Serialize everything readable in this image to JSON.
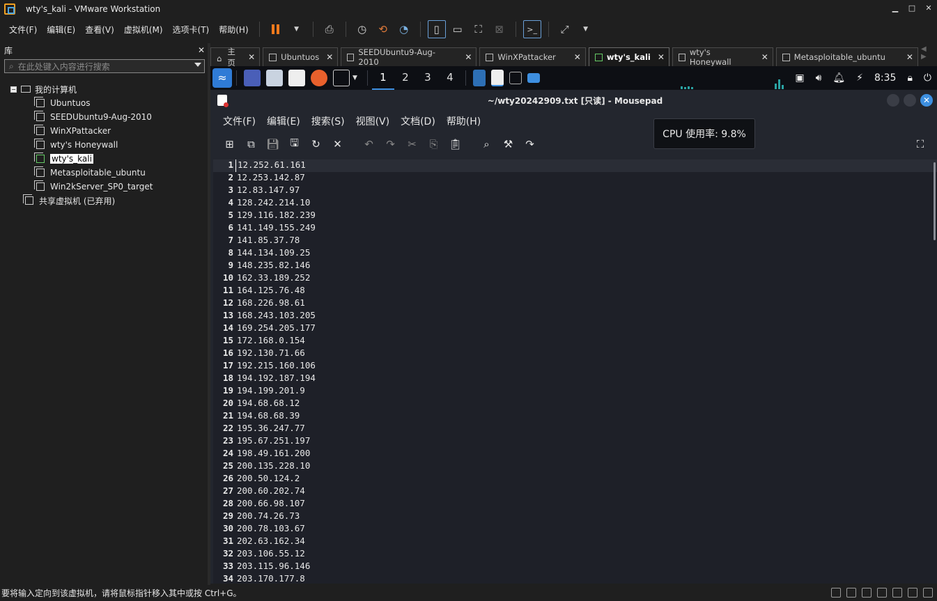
{
  "window": {
    "title": "wty's_kali - VMware Workstation",
    "controls": [
      "▁",
      "□",
      "✕"
    ]
  },
  "menubar": {
    "items": [
      "文件(F)",
      "编辑(E)",
      "查看(V)",
      "虚拟机(M)",
      "选项卡(T)",
      "帮助(H)"
    ]
  },
  "library": {
    "title": "库",
    "close": "✕",
    "search_placeholder": "在此处键入内容进行搜索",
    "tree": {
      "root": "我的计算机",
      "expander": "−",
      "vms": [
        "Ubuntuos",
        "SEEDUbuntu9-Aug-2010",
        "WinXPattacker",
        "wty's Honeywall",
        "wty's_kali",
        "Metasploitable_ubuntu",
        "Win2kServer_SP0_target"
      ],
      "selected_index": 4,
      "shared": "共享虚拟机 (已弃用)"
    }
  },
  "tabs": [
    {
      "label": "主页",
      "active": false
    },
    {
      "label": "Ubuntuos",
      "active": false
    },
    {
      "label": "SEEDUbuntu9-Aug-2010",
      "active": false
    },
    {
      "label": "WinXPattacker",
      "active": false
    },
    {
      "label": "wty's_kali",
      "active": true
    },
    {
      "label": "wty's Honeywall",
      "active": false
    },
    {
      "label": "Metasploitable_ubuntu",
      "active": false
    }
  ],
  "tab_close": "✕",
  "tab_nav": "◀  ▶",
  "guest_panel": {
    "workspaces": [
      "1",
      "2",
      "3",
      "4"
    ],
    "active_workspace": 0,
    "clock": "8:35",
    "cpu_tooltip": "CPU 使用率: 9.8%"
  },
  "mousepad": {
    "title": "~/wty20242909.txt [只读] - Mousepad",
    "menu": [
      "文件(F)",
      "编辑(E)",
      "搜索(S)",
      "视图(V)",
      "文档(D)",
      "帮助(H)"
    ],
    "lines": [
      "12.252.61.161",
      "12.253.142.87",
      "12.83.147.97",
      "128.242.214.10",
      "129.116.182.239",
      "141.149.155.249",
      "141.85.37.78",
      "144.134.109.25",
      "148.235.82.146",
      "162.33.189.252",
      "164.125.76.48",
      "168.226.98.61",
      "168.243.103.205",
      "169.254.205.177",
      "172.168.0.154",
      "192.130.71.66",
      "192.215.160.106",
      "194.192.187.194",
      "194.199.201.9",
      "194.68.68.12",
      "194.68.68.39",
      "195.36.247.77",
      "195.67.251.197",
      "198.49.161.200",
      "200.135.228.10",
      "200.50.124.2",
      "200.60.202.74",
      "200.66.98.107",
      "200.74.26.73",
      "200.78.103.67",
      "202.63.162.34",
      "203.106.55.12",
      "203.115.96.146",
      "203.170.177.8"
    ]
  },
  "statusbar": {
    "text": "要将输入定向到该虚拟机，请将鼠标指针移入其中或按 Ctrl+G。"
  }
}
